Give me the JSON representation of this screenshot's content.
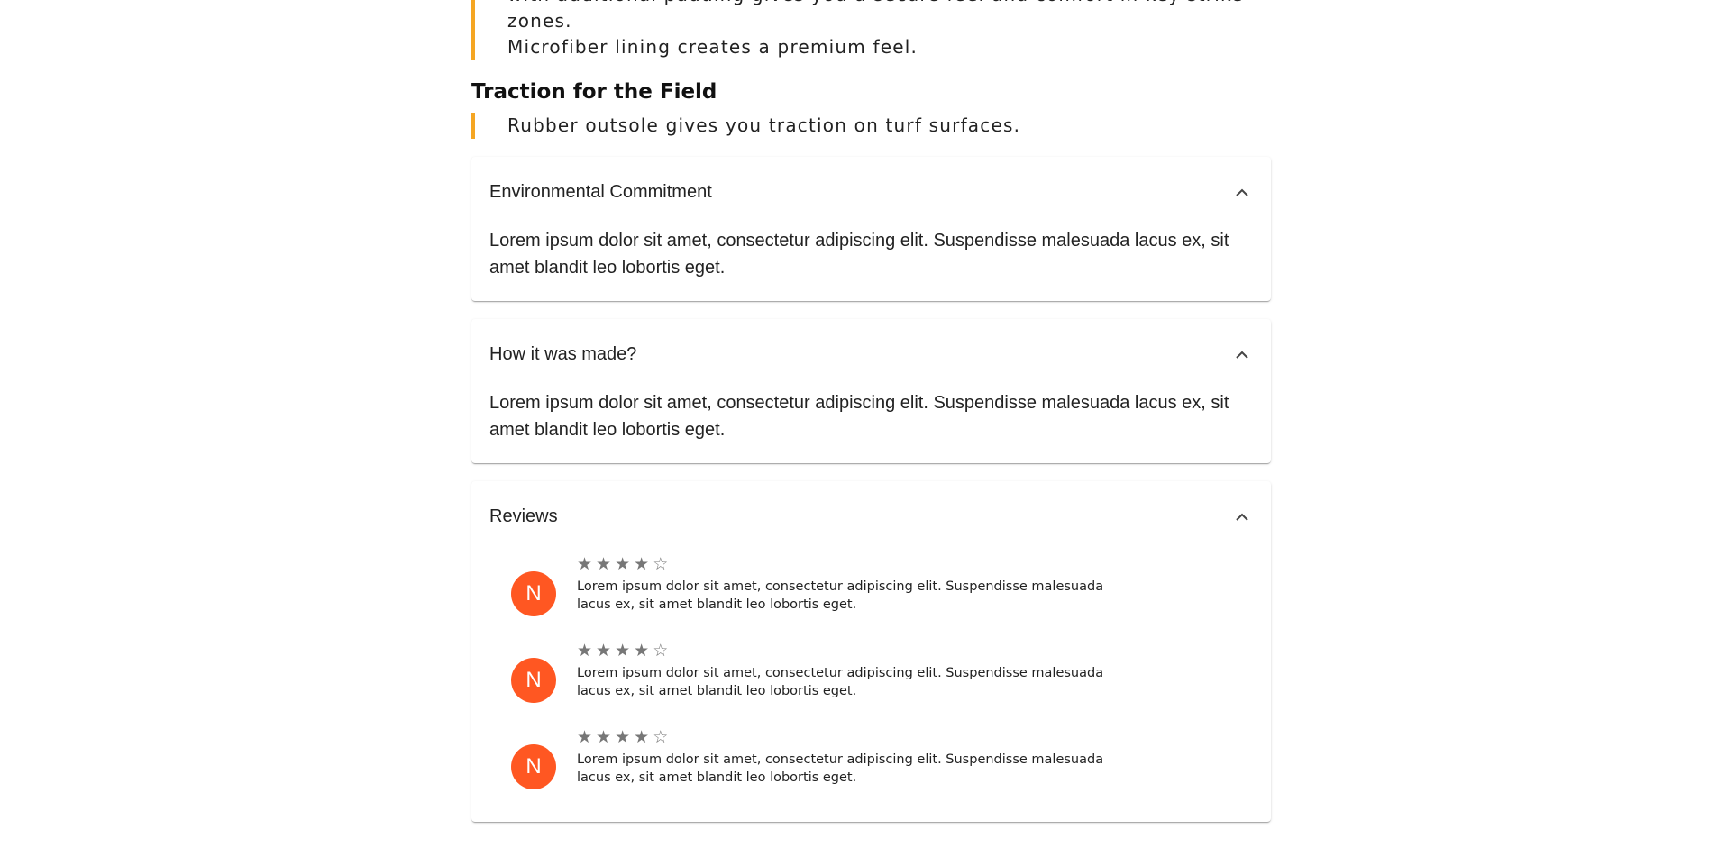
{
  "features": {
    "padding_text_line1": "with additional padding gives you a secure feel and comfort in key strike zones.",
    "padding_text_line2": "Microfiber lining creates a premium feel.",
    "traction_title": "Traction for the Field",
    "traction_text": "Rubber outsole gives you traction on turf surfaces."
  },
  "panels": {
    "environmental": {
      "title": "Environmental Commitment",
      "body": "Lorem ipsum dolor sit amet, consectetur adipiscing elit. Suspendisse malesuada lacus ex, sit amet blandit leo lobortis eget."
    },
    "made": {
      "title": "How it was made?",
      "body": "Lorem ipsum dolor sit amet, consectetur adipiscing elit. Suspendisse malesuada lacus ex, sit amet blandit leo lobortis eget."
    },
    "reviews": {
      "title": "Reviews",
      "items": [
        {
          "avatar_initial": "N",
          "rating": 4,
          "max_rating": 5,
          "text": "Lorem ipsum dolor sit amet, consectetur adipiscing elit. Suspendisse malesuada lacus ex, sit amet blandit leo lobortis eget."
        },
        {
          "avatar_initial": "N",
          "rating": 4,
          "max_rating": 5,
          "text": "Lorem ipsum dolor sit amet, consectetur adipiscing elit. Suspendisse malesuada lacus ex, sit amet blandit leo lobortis eget."
        },
        {
          "avatar_initial": "N",
          "rating": 4,
          "max_rating": 5,
          "text": "Lorem ipsum dolor sit amet, consectetur adipiscing elit. Suspendisse malesuada lacus ex, sit amet blandit leo lobortis eget."
        }
      ]
    }
  },
  "icons": {
    "collapse": "chevron-up-icon",
    "star_filled": "star-icon",
    "star_empty": "star-outline-icon"
  },
  "colors": {
    "accent": "#f5a623",
    "avatar": "#ff5722",
    "star": "#777777"
  }
}
